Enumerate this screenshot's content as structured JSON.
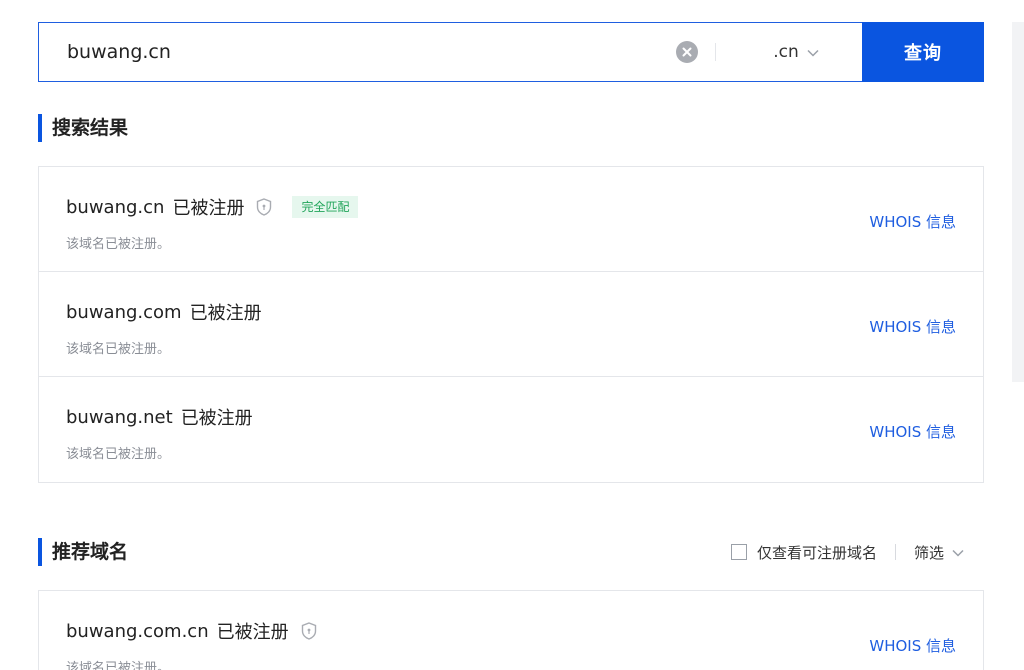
{
  "search": {
    "value": "buwang.cn",
    "suffix": ".cn",
    "button_label": "查询"
  },
  "results_section": {
    "title": "搜索结果",
    "items": [
      {
        "domain": "buwang.cn",
        "status": "已被注册",
        "desc": "该域名已被注册。",
        "badge": "完全匹配",
        "whois": "WHOIS 信息"
      },
      {
        "domain": "buwang.com",
        "status": "已被注册",
        "desc": "该域名已被注册。",
        "whois": "WHOIS 信息"
      },
      {
        "domain": "buwang.net",
        "status": "已被注册",
        "desc": "该域名已被注册。",
        "whois": "WHOIS 信息"
      }
    ]
  },
  "recommend_section": {
    "title": "推荐域名",
    "only_available_label": "仅查看可注册域名",
    "filter_label": "筛选",
    "items": [
      {
        "domain": "buwang.com.cn",
        "status": "已被注册",
        "desc": "该域名已被注册。",
        "whois": "WHOIS 信息"
      }
    ]
  },
  "colors": {
    "accent": "#0a55e0",
    "link": "#1f5ee0",
    "badge_bg": "#e6f7ee",
    "badge_text": "#22a55b"
  }
}
